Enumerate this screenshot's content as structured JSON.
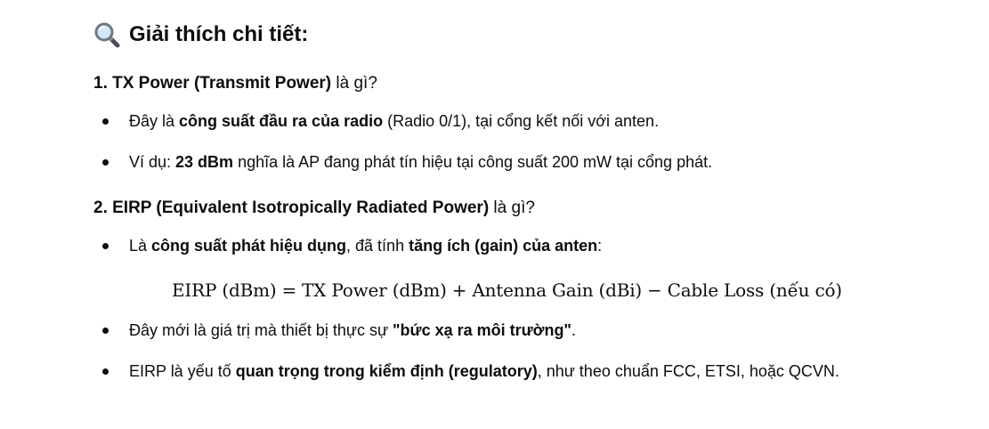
{
  "heading": {
    "icon": "magnifying-glass-icon",
    "text": "Giải thích chi tiết:"
  },
  "sections": [
    {
      "title_bold": "1. TX Power (Transmit Power)",
      "title_rest": " là gì?",
      "bullets": [
        {
          "parts": [
            {
              "t": "Đây là ",
              "b": false
            },
            {
              "t": "công suất đầu ra của radio",
              "b": true
            },
            {
              "t": " (Radio 0/1), tại cổng kết nối với anten.",
              "b": false
            }
          ]
        },
        {
          "parts": [
            {
              "t": "Ví dụ: ",
              "b": false
            },
            {
              "t": "23 dBm",
              "b": true
            },
            {
              "t": " nghĩa là AP đang phát tín hiệu tại công suất 200 mW tại cổng phát.",
              "b": false
            }
          ]
        }
      ]
    },
    {
      "title_bold": "2. EIRP (Equivalent Isotropically Radiated Power)",
      "title_rest": " là gì?",
      "bullets": [
        {
          "parts": [
            {
              "t": "Là ",
              "b": false
            },
            {
              "t": "công suất phát hiệu dụng",
              "b": true
            },
            {
              "t": ", đã tính ",
              "b": false
            },
            {
              "t": "tăng ích (gain) của anten",
              "b": true
            },
            {
              "t": ":",
              "b": false
            }
          ]
        },
        {
          "parts": [
            {
              "t": "Đây mới là giá trị mà thiết bị thực sự ",
              "b": false
            },
            {
              "t": "\"bức xạ ra môi trường\"",
              "b": true
            },
            {
              "t": ".",
              "b": false
            }
          ]
        },
        {
          "parts": [
            {
              "t": "EIRP là yếu tố ",
              "b": false
            },
            {
              "t": "quan trọng trong kiểm định (regulatory)",
              "b": true
            },
            {
              "t": ", như theo chuẩn FCC, ETSI, hoặc QCVN.",
              "b": false
            }
          ]
        }
      ]
    }
  ],
  "formula": {
    "lhs": "EIRP (dBm)",
    "eq": "=",
    "t1": "TX Power (dBm)",
    "plus": "+",
    "t2": "Antenna Gain (dBi)",
    "minus": "−",
    "t3": "Cable Loss (nếu có)"
  }
}
